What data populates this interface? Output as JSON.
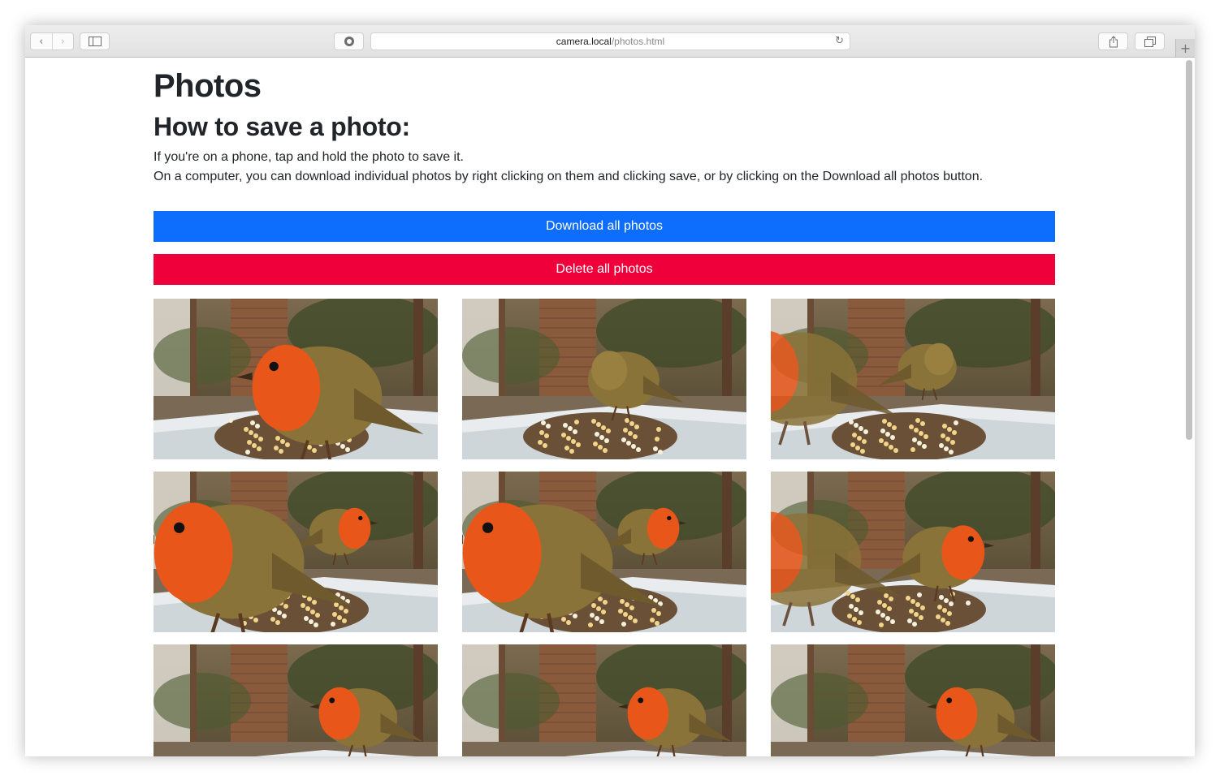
{
  "browser": {
    "url_host": "camera.local",
    "url_path": "/photos.html",
    "icons": {
      "back": "chevron-left-icon",
      "forward": "chevron-right-icon",
      "sidebar": "sidebar-icon",
      "privacy": "privacy-report-icon",
      "reload": "reload-icon",
      "share": "share-icon",
      "tabs": "tab-overview-icon",
      "new_tab": "plus-icon"
    }
  },
  "page": {
    "title": "Photos",
    "subtitle": "How to save a photo:",
    "instructions": [
      "If you're on a phone, tap and hold the photo to save it.",
      "On a computer, you can download individual photos by right clicking on them and clicking save, or by clicking on the Download all photos button."
    ]
  },
  "buttons": {
    "download_all": "Download all photos",
    "delete_all": "Delete all photos"
  },
  "colors": {
    "download_button": "#0d6efd",
    "delete_button": "#f0003a",
    "text": "#212529"
  },
  "photos": [
    {
      "subject": "robin-close-up"
    },
    {
      "subject": "robin-from-behind"
    },
    {
      "subject": "robin-in-background"
    },
    {
      "subject": "two-robins-feeding"
    },
    {
      "subject": "two-robins-feeding"
    },
    {
      "subject": "robin-perched"
    },
    {
      "subject": "robin-on-feeder"
    },
    {
      "subject": "robin-on-feeder"
    },
    {
      "subject": "robin-on-feeder"
    }
  ]
}
